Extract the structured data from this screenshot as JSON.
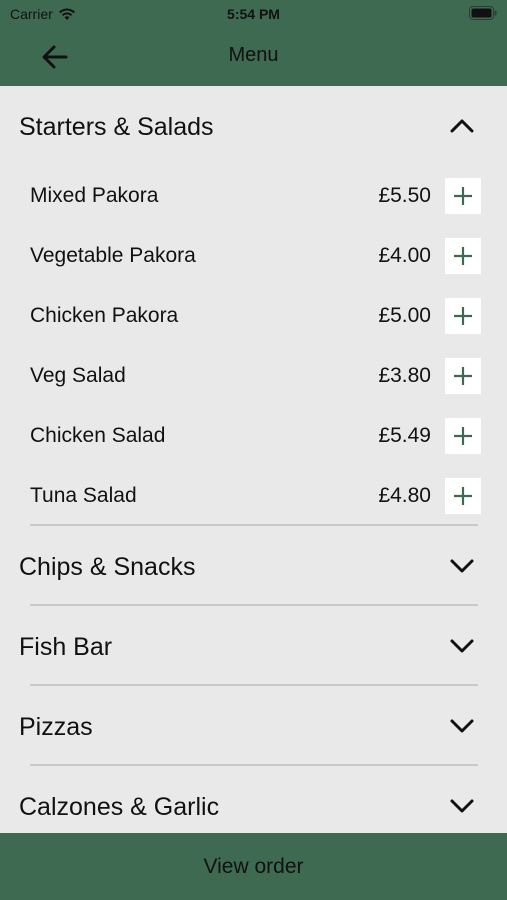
{
  "status_bar": {
    "carrier": "Carrier",
    "time": "5:54 PM"
  },
  "nav": {
    "title": "Menu"
  },
  "sections": [
    {
      "title": "Starters & Salads",
      "expanded": true,
      "items": [
        {
          "name": "Mixed Pakora",
          "price": "£5.50"
        },
        {
          "name": "Vegetable Pakora",
          "price": "£4.00"
        },
        {
          "name": "Chicken Pakora",
          "price": "£5.00"
        },
        {
          "name": "Veg Salad",
          "price": "£3.80"
        },
        {
          "name": "Chicken Salad",
          "price": "£5.49"
        },
        {
          "name": "Tuna Salad",
          "price": "£4.80"
        }
      ]
    },
    {
      "title": "Chips & Snacks",
      "expanded": false
    },
    {
      "title": "Fish Bar",
      "expanded": false
    },
    {
      "title": "Pizzas",
      "expanded": false
    },
    {
      "title": "Calzones & Garlic",
      "expanded": false
    }
  ],
  "footer": {
    "label": "View order"
  },
  "colors": {
    "brand_green": "#3f6a52",
    "background": "#e9e9e9",
    "plus_green": "#3f6a52"
  },
  "icons": {
    "back": "arrow-left-icon",
    "expanded": "chevron-up-icon",
    "collapsed": "chevron-down-icon",
    "add": "plus-icon"
  }
}
